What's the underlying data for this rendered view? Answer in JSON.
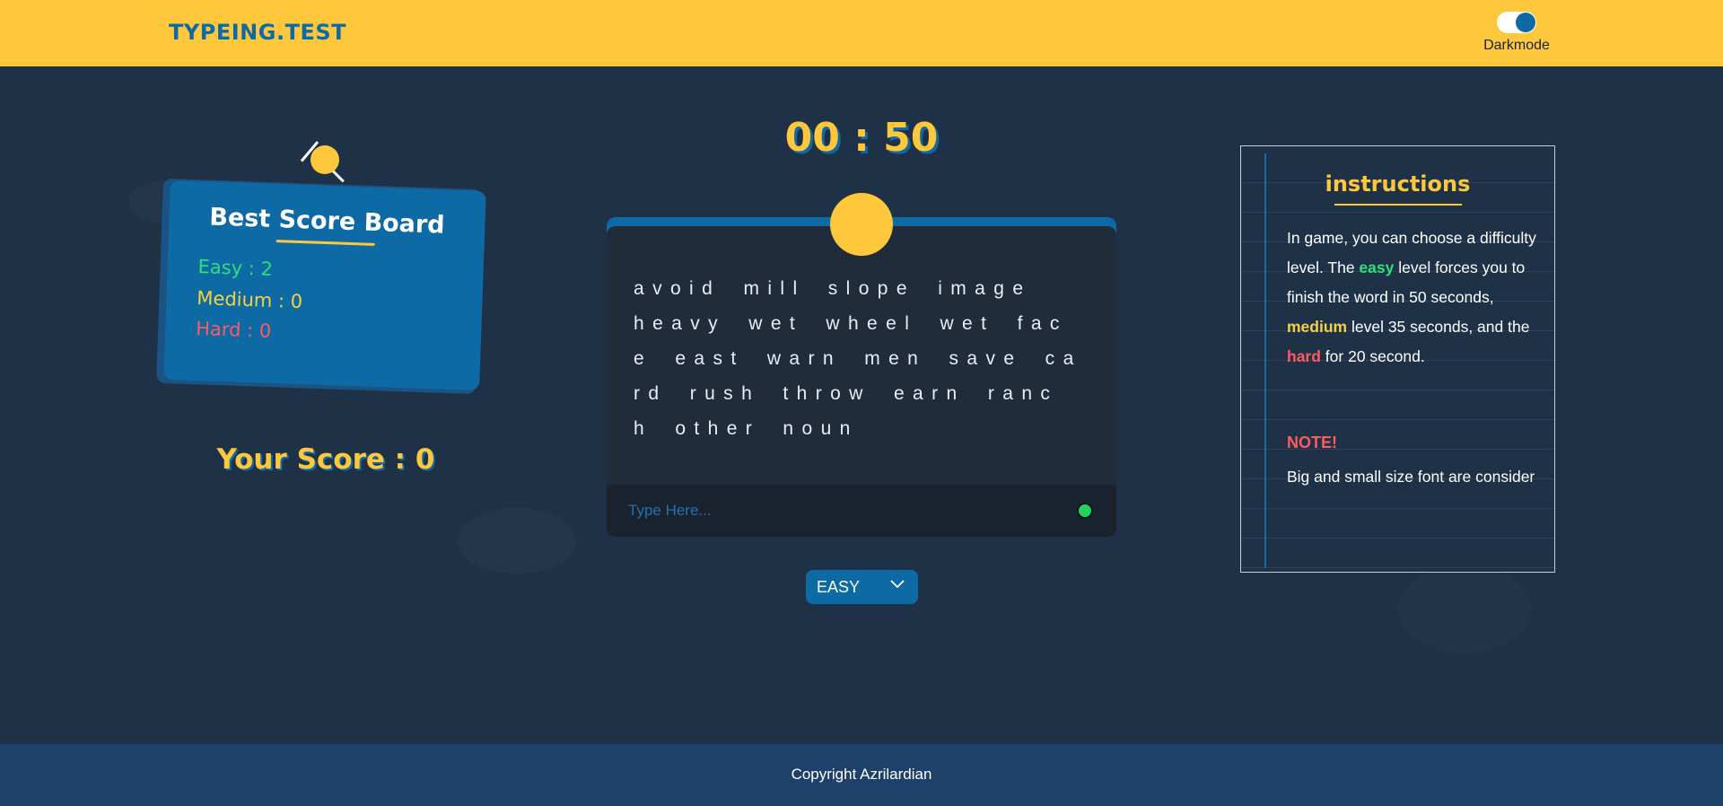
{
  "header": {
    "logo": "TYPEING.TEST",
    "darkmode_label": "Darkmode"
  },
  "scoreboard": {
    "title": "Best Score Board",
    "easy": "Easy : 2",
    "medium": "Medium : 0",
    "hard": "Hard : 0"
  },
  "your_score": "Your Score : 0",
  "timer": "00 : 50",
  "words": "avoid mill slope image heavy wet wheel wet fac\ne east warn men save ca\nrd rush throw earn ranc\nh other noun",
  "input": {
    "placeholder": "Type Here..."
  },
  "difficulty": {
    "selected": "EASY"
  },
  "instructions": {
    "title": "instructions",
    "p1_before": "In game, you can choose a difficulty level. The ",
    "p1_easy": "easy",
    "p1_mid1": " level forces you to finish the word in 50 seconds, ",
    "p1_medium": "medium",
    "p1_mid2": " level 35 seconds, and the ",
    "p1_hard": "hard",
    "p1_after": " for 20 second.",
    "note_title": "NOTE!",
    "note_body": "Big and small size font are consider"
  },
  "footer": {
    "copyright": "Copyright Azrilardian"
  },
  "colors": {
    "accent_yellow": "#fec73c",
    "accent_blue": "#0e6aa4",
    "easy_green": "#2de07a",
    "medium_yellow": "#f4d33f",
    "hard_red": "#ff5a5f",
    "status_green": "#22d35b"
  },
  "icons": {
    "toggle": "toggle-switch",
    "chevron": "chevron-down-icon",
    "status": "status-dot"
  }
}
